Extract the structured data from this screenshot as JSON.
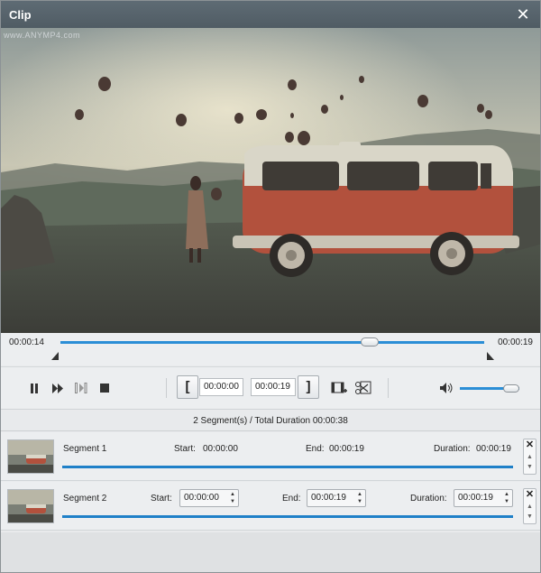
{
  "window": {
    "title": "Clip",
    "close_label": "✕"
  },
  "video": {
    "watermark": "www.ANYMP4.com"
  },
  "timeline": {
    "start_time": "00:00:14",
    "end_time": "00:00:19",
    "progress": 0.73
  },
  "controls": {
    "icons": [
      "pause-icon",
      "fast-forward-icon",
      "next-frame-icon",
      "stop-icon",
      "add-segment-icon",
      "split-icon",
      "volume-icon"
    ],
    "set_start_label": "[",
    "start_time": "00:00:00",
    "end_time": "00:00:19",
    "set_end_label": "]",
    "volume_level": 0.85
  },
  "summary": {
    "text": "2 Segment(s) / Total Duration 00:00:38"
  },
  "segments": [
    {
      "name": "Segment 1",
      "start_label": "Start:",
      "start": "00:00:00",
      "end_label": "End:",
      "end": "00:00:19",
      "duration_label": "Duration:",
      "duration": "00:00:19"
    },
    {
      "name": "Segment 2",
      "start_label": "Start:",
      "start": "00:00:00",
      "end_label": "End:",
      "end": "00:00:19",
      "duration_label": "Duration:",
      "duration": "00:00:19"
    }
  ],
  "colors": {
    "accent": "#2b8ed6",
    "titlebar": "#56626b",
    "van_body": "#b2513d"
  }
}
